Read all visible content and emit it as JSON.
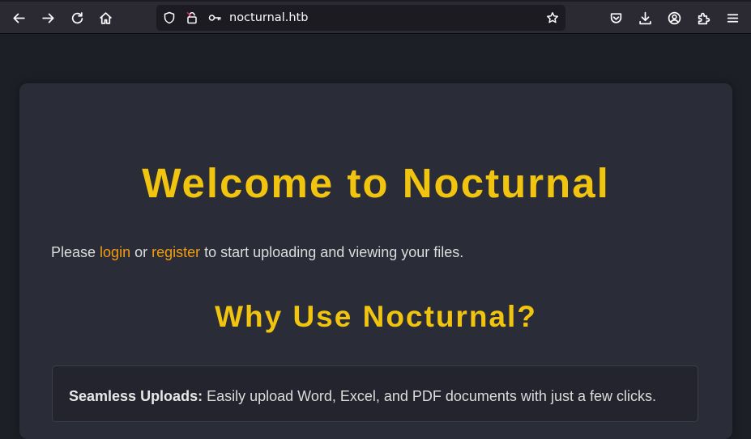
{
  "browser": {
    "url": "nocturnal.htb",
    "toolbar_icons": [
      "back-icon",
      "forward-icon",
      "reload-icon",
      "home-icon",
      "shield-icon",
      "lock-insecure-icon",
      "key-icon",
      "star-icon",
      "pocket-icon",
      "download-icon",
      "account-icon",
      "extensions-icon",
      "menu-icon"
    ]
  },
  "page": {
    "title": "Welcome to Nocturnal",
    "intro": {
      "prefix": "Please ",
      "login_link": "login",
      "middle": " or ",
      "register_link": "register",
      "suffix": " to start uploading and viewing your files."
    },
    "subtitle": "Why Use Nocturnal?",
    "features": [
      {
        "heading": "Seamless Uploads:",
        "text": " Easily upload Word, Excel, and PDF documents with just a few clicks."
      }
    ]
  },
  "colors": {
    "accent_yellow": "#f1c40f",
    "link_orange": "#f39c12",
    "page_bg": "#1d1f27",
    "card_bg": "#2a2c37"
  }
}
